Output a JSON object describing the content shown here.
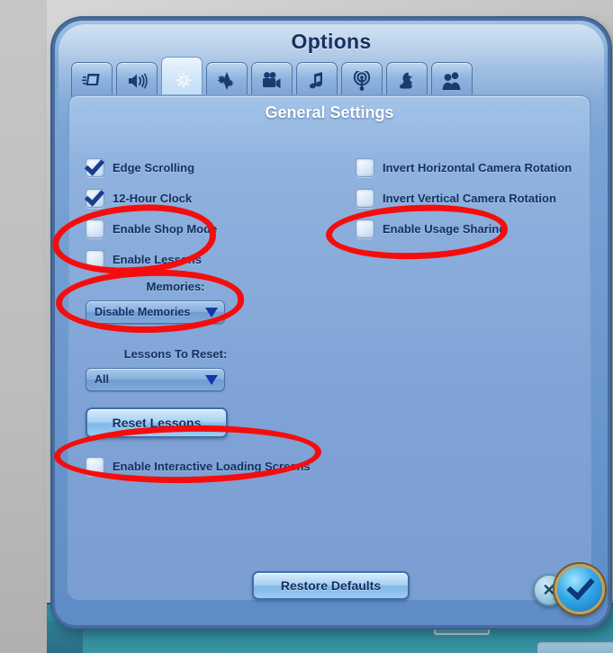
{
  "window": {
    "title": "Options"
  },
  "tabs": [
    {
      "id": "game",
      "icon": "book-screen-icon",
      "active": false
    },
    {
      "id": "audio",
      "icon": "speaker-icon",
      "active": false
    },
    {
      "id": "general",
      "icon": "gears-icon",
      "active": true
    },
    {
      "id": "graphics",
      "icon": "plumbob-gear-icon",
      "active": false
    },
    {
      "id": "camera",
      "icon": "movie-camera-icon",
      "active": false
    },
    {
      "id": "music",
      "icon": "music-note-icon",
      "active": false
    },
    {
      "id": "online",
      "icon": "broadcast-icon",
      "active": false
    },
    {
      "id": "weather",
      "icon": "moon-cloud-icon",
      "active": false
    },
    {
      "id": "sims",
      "icon": "two-people-icon",
      "active": false
    }
  ],
  "panel": {
    "header": "General Settings",
    "left_checkboxes": [
      {
        "label": "Edge Scrolling",
        "checked": true
      },
      {
        "label": "12-Hour Clock",
        "checked": true
      },
      {
        "label": "Enable Shop Mode",
        "checked": false
      },
      {
        "label": "Enable Lessons",
        "checked": false
      }
    ],
    "right_checkboxes": [
      {
        "label": "Invert Horizontal Camera Rotation",
        "checked": false
      },
      {
        "label": "Invert Vertical Camera Rotation",
        "checked": false
      },
      {
        "label": "Enable Usage Sharing",
        "checked": false
      }
    ],
    "memories": {
      "label": "Memories:",
      "value": "Disable Memories"
    },
    "lessons_to_reset": {
      "label": "Lessons To Reset:",
      "value": "All"
    },
    "reset_lessons_button": "Reset Lessons",
    "interactive_loading": {
      "label": "Enable Interactive Loading Screens",
      "checked": false
    },
    "restore_defaults_button": "Restore Defaults"
  },
  "footer": {
    "cancel_glyph": "✕",
    "accept_name": "accept-checkmark"
  },
  "annotations": {
    "color": "#f50d0d",
    "marks": [
      "circle-around-enable-shop-mode-and-enable-lessons",
      "circle-around-memories-dropdown",
      "circle-around-enable-usage-sharing",
      "circle-around-enable-interactive-loading-screens"
    ]
  }
}
